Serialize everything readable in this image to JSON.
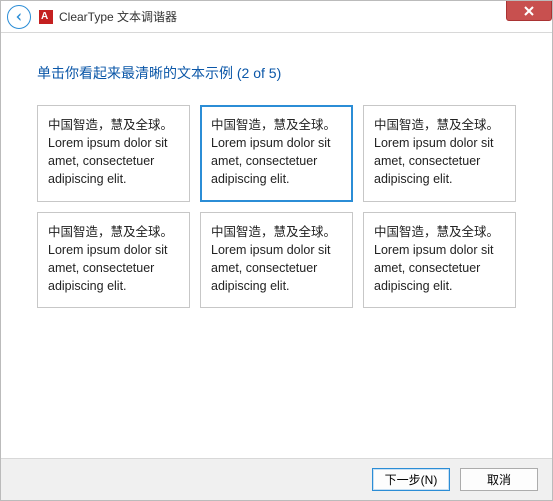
{
  "window": {
    "title": "ClearType 文本调谐器"
  },
  "instruction": "单击你看起来最清晰的文本示例 (2 of 5)",
  "sample_text": {
    "cn": "中国智造，慧及全球。",
    "en": "Lorem ipsum dolor sit amet, consectetuer adipiscing elit."
  },
  "samples": [
    {
      "id": 0,
      "selected": false
    },
    {
      "id": 1,
      "selected": true
    },
    {
      "id": 2,
      "selected": false
    },
    {
      "id": 3,
      "selected": false
    },
    {
      "id": 4,
      "selected": false
    },
    {
      "id": 5,
      "selected": false
    }
  ],
  "buttons": {
    "next": "下一步(N)",
    "cancel": "取消"
  }
}
